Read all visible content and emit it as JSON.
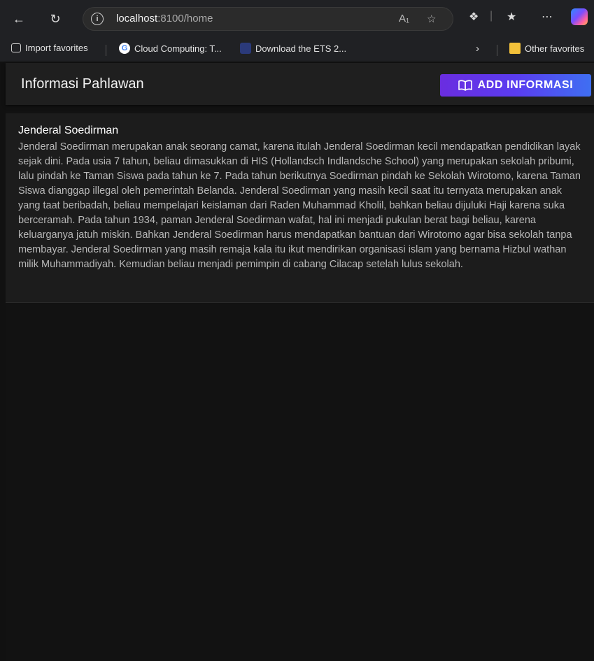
{
  "browser": {
    "url_host": "localhost",
    "url_rest": ":8100/home",
    "favorites": [
      {
        "label": "Import favorites",
        "icon": "import-icon"
      },
      {
        "label": "Cloud Computing: T...",
        "icon": "google-icon"
      },
      {
        "label": "Download the ETS 2...",
        "icon": "ets-icon"
      }
    ],
    "other_favorites": "Other favorites"
  },
  "app": {
    "title": "Informasi Pahlawan",
    "add_button": "ADD INFORMASI",
    "accent_start": "#6a2de0",
    "accent_end": "#3f6ff2",
    "card": {
      "title": "Jenderal Soedirman",
      "body": "Jenderal Soedirman merupakan anak seorang camat, karena itulah Jenderal Soedirman kecil mendapatkan pendidikan layak sejak dini. Pada usia 7 tahun, beliau dimasukkan di HIS (Hollandsch Indlandsche School) yang merupakan sekolah pribumi, lalu pindah ke Taman Siswa pada tahun ke 7. Pada tahun berikutnya Soedirman pindah ke Sekolah Wirotomo, karena Taman Siswa dianggap illegal oleh pemerintah Belanda. Jenderal Soedirman yang masih kecil saat itu ternyata merupakan anak yang taat beribadah, beliau mempelajari keislaman dari Raden Muhammad Kholil, bahkan beliau dijuluki Haji karena suka berceramah. Pada tahun 1934, paman Jenderal Soedirman wafat, hal ini menjadi pukulan berat bagi beliau, karena keluarganya jatuh miskin. Bahkan Jenderal Soedirman harus mendapatkan bantuan dari Wirotomo agar bisa sekolah tanpa membayar. Jenderal Soedirman yang masih remaja kala itu ikut mendirikan organisasi islam yang bernama Hizbul wathan milik Muhammadiyah. Kemudian beliau menjadi pemimpin di cabang Cilacap setelah lulus sekolah."
    }
  }
}
